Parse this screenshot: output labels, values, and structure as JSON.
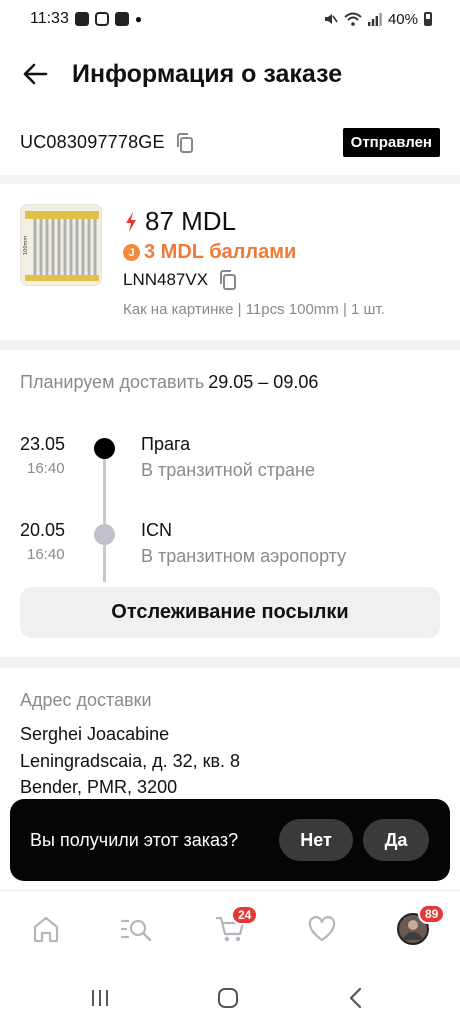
{
  "status_bar": {
    "time": "11:33",
    "battery": "40%"
  },
  "header": {
    "title": "Информация о заказе"
  },
  "order": {
    "id": "UC083097778GE",
    "status": "Отправлен"
  },
  "product": {
    "price": "87 MDL",
    "points_icon_letter": "J",
    "points": "3 MDL баллами",
    "sku": "LNN487VX",
    "variant": "Как на картинке | 11pcs 100mm | 1 шт.",
    "image_label": "100mm"
  },
  "delivery": {
    "plan_label": "Планируем доставить",
    "plan_dates": "29.05 – 09.06",
    "events": [
      {
        "date": "23.05",
        "time": "16:40",
        "place": "Прага",
        "description": "В транзитной стране"
      },
      {
        "date": "20.05",
        "time": "16:40",
        "place": "ICN",
        "description": "В транзитном аэропорту"
      }
    ],
    "track_button": "Отслеживание посылки"
  },
  "address": {
    "title": "Адрес доставки",
    "lines": [
      "Serghei Joacabine",
      "Leningradscaia, д. 32, кв. 8",
      "Bender, PMR, 3200"
    ]
  },
  "toast": {
    "question": "Вы получили этот заказ?",
    "no_label": "Нет",
    "yes_label": "Да"
  },
  "bottom_nav": {
    "items": [
      {
        "name": "home",
        "icon": "home-icon"
      },
      {
        "name": "search",
        "icon": "search-list-icon"
      },
      {
        "name": "cart",
        "icon": "cart-icon",
        "badge": "24"
      },
      {
        "name": "wishlist",
        "icon": "heart-icon"
      },
      {
        "name": "account",
        "icon": "avatar",
        "badge": "89"
      }
    ]
  },
  "colors": {
    "accent": "#ef7a3a",
    "badge": "#e53935",
    "status_badge_bg": "#000000",
    "flash": "#e53935"
  }
}
